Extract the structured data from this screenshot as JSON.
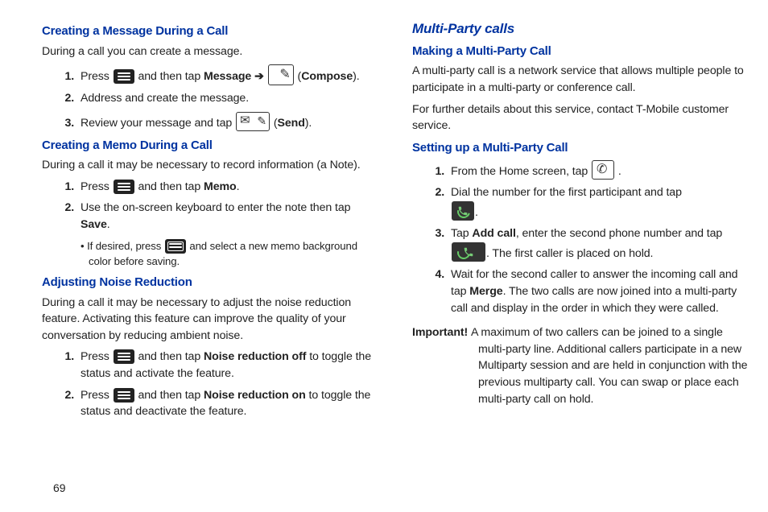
{
  "page_number": "69",
  "left": {
    "sec1_title": "Creating a Message During a Call",
    "sec1_intro": "During a call you can create a message.",
    "sec1_li1_a": "Press ",
    "sec1_li1_b": " and then tap ",
    "sec1_li1_msg": "Message",
    "sec1_li1_arrow": " ➔ ",
    "sec1_li1_compose": "Compose",
    "sec1_li2": "Address and create the message.",
    "sec1_li3_a": "Review your message and tap ",
    "sec1_li3_send": "Send",
    "sec2_title": "Creating a Memo During a Call",
    "sec2_intro": "During a call it may be necessary to record information (a Note).",
    "sec2_li1_a": "Press ",
    "sec2_li1_b": " and then tap ",
    "sec2_li1_memo": "Memo",
    "sec2_li2_a": "Use the on-screen keyboard to enter the note then tap ",
    "sec2_li2_save": "Save",
    "sec2_sub_a": "• If desired, press ",
    "sec2_sub_b": " and select a new memo background color before saving.",
    "sec3_title": "Adjusting Noise Reduction",
    "sec3_intro": "During a call it may be necessary to adjust the noise reduction feature. Activating this feature can improve the quality of your conversation by reducing ambient noise.",
    "sec3_li1_a": "Press ",
    "sec3_li1_b": " and then tap ",
    "sec3_li1_nr": "Noise reduction off",
    "sec3_li1_c": " to toggle the status and activate the feature.",
    "sec3_li2_a": "Press ",
    "sec3_li2_b": " and then tap ",
    "sec3_li2_nr": "Noise reduction on",
    "sec3_li2_c": " to toggle the status and deactivate the feature."
  },
  "right": {
    "h2": "Multi-Party calls",
    "sec1_title": "Making a Multi-Party Call",
    "sec1_p1": "A multi-party call is a network service that allows multiple people to participate in a multi-party or conference call.",
    "sec1_p2": "For further details about this service, contact T-Mobile customer service.",
    "sec2_title": "Setting up a Multi-Party Call",
    "sec2_li1_a": "From the Home screen, tap ",
    "sec2_li1_b": " .",
    "sec2_li2_a": "Dial the number for the first participant and tap ",
    "sec2_li2_b": ".",
    "sec2_li3_a": "Tap ",
    "sec2_li3_add": "Add call",
    "sec2_li3_b": ", enter the second phone number and tap ",
    "sec2_li3_c": ". The first caller is placed on hold.",
    "sec2_li4_a": "Wait for the second caller to answer the incoming call and tap ",
    "sec2_li4_merge": "Merge",
    "sec2_li4_b": ". The two calls are now joined into a multi-party call and display in the order in which they were called.",
    "important_label": "Important! ",
    "important_body": "A maximum of two callers can be joined to a single multi-party line. Additional callers participate in a new Multiparty session and are held in conjunction with the previous multiparty call. You can swap or place each multi-party call on hold."
  }
}
